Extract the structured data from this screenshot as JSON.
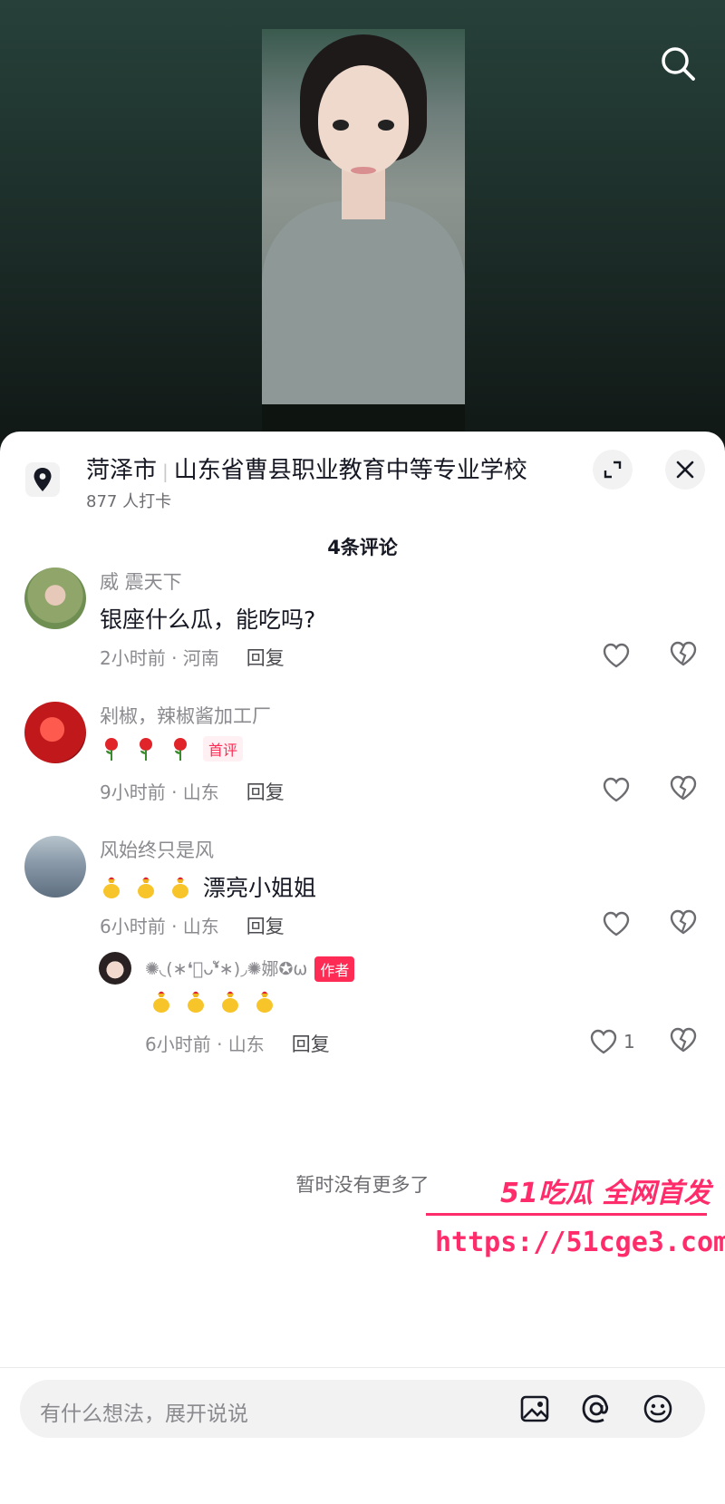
{
  "location": {
    "city": "菏泽市",
    "place": "山东省曹县职业教育中等专业学校",
    "checkins": "877 人打卡"
  },
  "comments_count": "4条评论",
  "comments": [
    {
      "name": "威 震天下",
      "text": "银座什么瓜，能吃吗?",
      "time": "2小时前 · 河南",
      "reply": "回复",
      "avatar_color": "#8fa56a"
    },
    {
      "name": "剁椒，辣椒酱加工厂",
      "text": "",
      "emoji": [
        "rose",
        "rose",
        "rose"
      ],
      "badge": "首评",
      "time": "9小时前 · 山东",
      "reply": "回复",
      "avatar_color": "#c0181b"
    },
    {
      "name": "风始终只是风",
      "text": "漂亮小姐姐",
      "emoji": [
        "money-bag",
        "money-bag",
        "money-bag"
      ],
      "time": "6小时前 · 山东",
      "reply": "回复",
      "avatar_color": "#8898a8"
    }
  ],
  "sub_reply": {
    "name": "✺◟(∗❛ัᴗ❛ั∗)◞✺娜✪ω",
    "badge": "作者",
    "emoji": [
      "money-bag",
      "money-bag",
      "money-bag",
      "money-bag"
    ],
    "time": "6小时前 · 山东",
    "reply": "回复",
    "likes": "1"
  },
  "no_more": "暂时没有更多了",
  "watermark": {
    "line1": "51吃瓜 全网首发",
    "line2": "https://51cge3.com"
  },
  "input": {
    "placeholder": "有什么想法，展开说说"
  },
  "colors": {
    "accent": "#fe2c55",
    "watermark": "#fe2c6a"
  }
}
